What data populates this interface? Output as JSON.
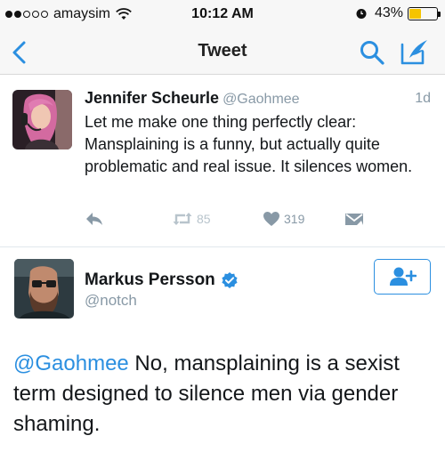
{
  "status_bar": {
    "carrier": "amaysim",
    "time": "10:12 AM",
    "battery_percent": "43%",
    "battery_level": 0.43,
    "battery_color": "#f5c400"
  },
  "nav": {
    "title": "Tweet",
    "icons": [
      "back-chevron-icon",
      "search-icon",
      "compose-tweet-icon"
    ],
    "accent_color": "#2b8fe0"
  },
  "tweet1": {
    "name": "Jennifer Scheurle",
    "handle": "@Gaohmee",
    "time": "1d",
    "text": "Let me make one thing perfectly clear: Mansplaining is a funny, but actually quite problematic and real issue. It silences women.",
    "actions": {
      "reply_icon": "reply-icon",
      "retweet_count": "85",
      "like_count": "319",
      "dm_icon": "direct-message-icon"
    }
  },
  "tweet2": {
    "name": "Markus Persson",
    "handle": "@notch",
    "verified": true,
    "follow_icon": "follow-user-icon",
    "mention": "@Gaohmee",
    "text": " No, mansplaining is a sexist term designed to silence men via gender shaming."
  }
}
